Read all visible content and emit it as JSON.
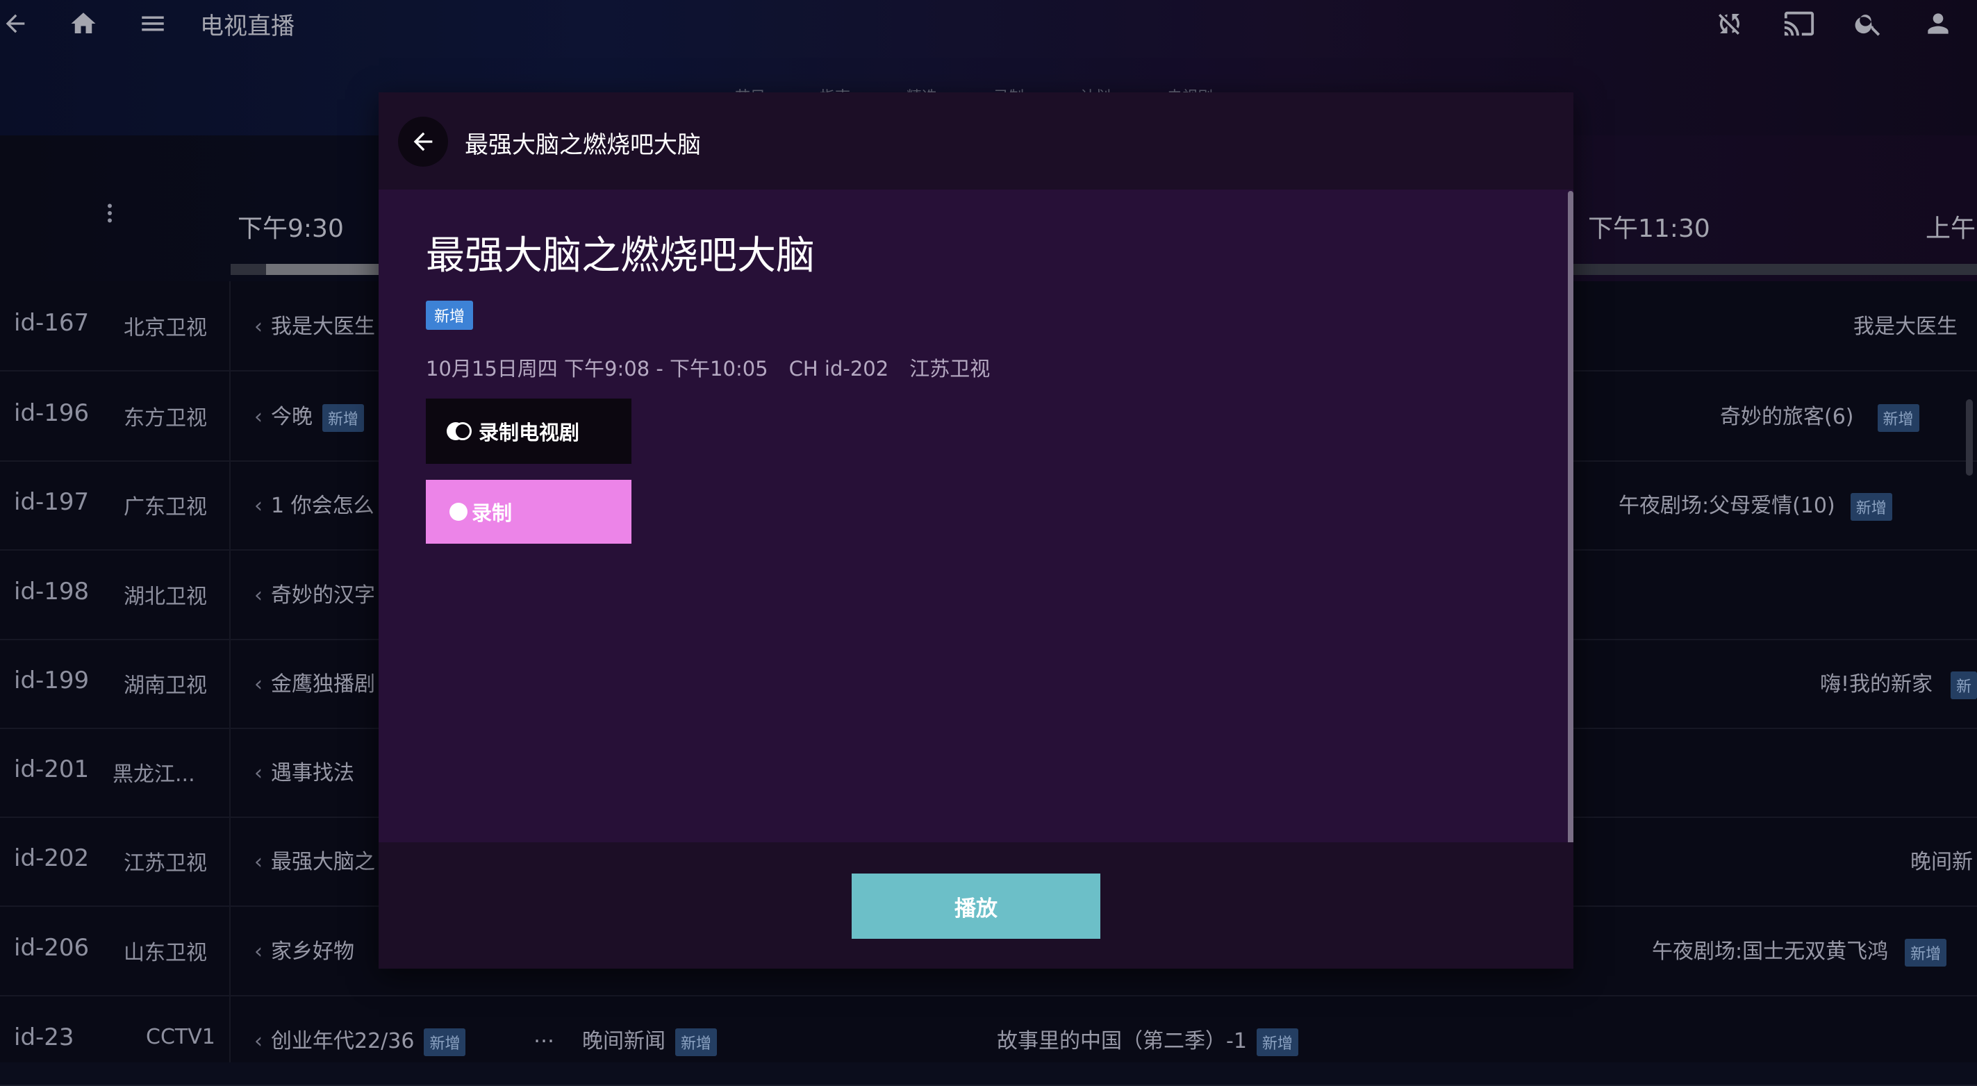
{
  "app": {
    "title": "电视直播"
  },
  "top_tabs": [
    "节目",
    "指南",
    "精选",
    "录制",
    "计划",
    "电视剧"
  ],
  "icons": {
    "back": "arrow-left-icon",
    "home": "home-icon",
    "menu": "hamburger-menu-icon",
    "sync_off": "sync-disabled-icon",
    "cast": "cast-icon",
    "search": "search-icon",
    "account": "account-icon",
    "more": "more-vert-icon"
  },
  "guide": {
    "times": [
      "下午9:30",
      "下午11:30",
      "上午"
    ],
    "progress_fraction": 0.07,
    "new_label": "新增",
    "more_label": "…",
    "rows": [
      {
        "id": "id-167",
        "channel": "北京卫视",
        "program": "我是大医生",
        "right": "我是大医生",
        "right_badge": ""
      },
      {
        "id": "id-196",
        "channel": "东方卫视",
        "program": "今晚",
        "badge": "新增",
        "right": "奇妙的旅客(6)",
        "right_badge": "新增"
      },
      {
        "id": "id-197",
        "channel": "广东卫视",
        "program": "1  你会怎么",
        "right": "午夜剧场:父母爱情(10)",
        "right_badge": "新增"
      },
      {
        "id": "id-198",
        "channel": "湖北卫视",
        "program": "奇妙的汉字",
        "right": "",
        "right_badge": ""
      },
      {
        "id": "id-199",
        "channel": "湖南卫视",
        "program": "金鹰独播剧",
        "right": "嗨!我的新家",
        "right_badge": "新"
      },
      {
        "id": "id-201",
        "channel": "黑龙江...",
        "program": "遇事找法",
        "right": "",
        "right_badge": ""
      },
      {
        "id": "id-202",
        "channel": "江苏卫视",
        "program": "最强大脑之",
        "right": "晚间新",
        "right_badge": ""
      },
      {
        "id": "id-206",
        "channel": "山东卫视",
        "program": "家乡好物",
        "right": "午夜剧场:国士无双黄飞鸿",
        "right_badge": "新增"
      },
      {
        "id": "id-23",
        "channel": "CCTV1",
        "program": "创业年代22/36",
        "badge": "新增",
        "extra1": "晚间新闻",
        "extra1_badge": "新增",
        "extra2": "故事里的中国（第二季）-1",
        "extra2_badge": "新增"
      }
    ]
  },
  "dialog": {
    "header_title": "最强大脑之燃烧吧大脑",
    "title": "最强大脑之燃烧吧大脑",
    "badge": "新增",
    "datetime": "10月15日周四 下午9:08 - 下午10:05",
    "channel_number": "CH id-202",
    "channel_name": "江苏卫视",
    "record_series_label": "录制电视剧",
    "record_label": "录制",
    "play_label": "播放"
  },
  "colors": {
    "dialog_bg": "#271037",
    "record_button": "#ec84e8",
    "play_button": "#6cbfc8",
    "badge_blue": "#3d82d6"
  }
}
